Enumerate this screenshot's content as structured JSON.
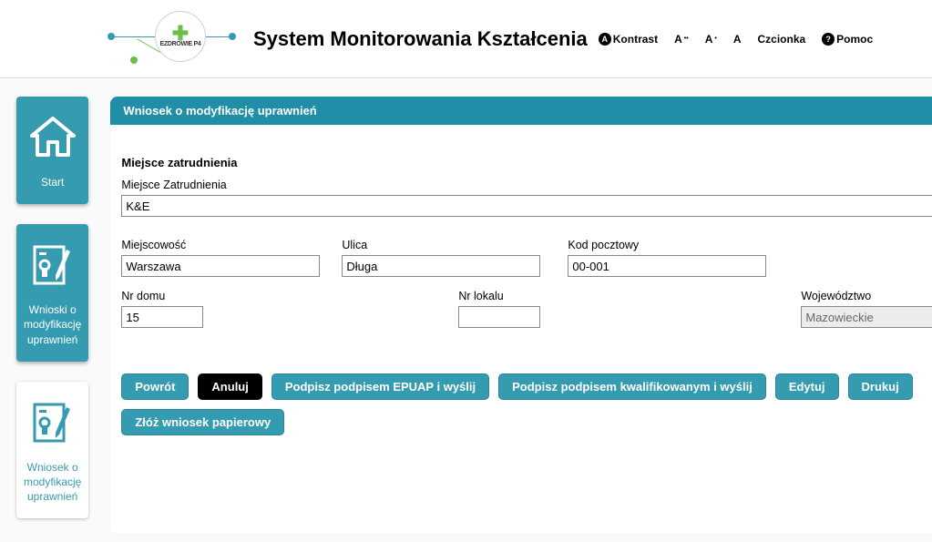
{
  "header": {
    "logo_text": "EZDROWIE P4",
    "app_title": "System Monitorowania Kształcenia",
    "kontrast": "Kontrast",
    "a_large": "A",
    "a_med": "A",
    "a_small": "A",
    "czcionka": "Czcionka",
    "pomoc": "Pomoc"
  },
  "sidebar": {
    "items": [
      {
        "label": "Start"
      },
      {
        "label": "Wnioski o\nmodyfikację\nuprawnień"
      },
      {
        "label": "Wniosek o\nmodyfikację\nuprawnień"
      }
    ]
  },
  "panel": {
    "title": "Wniosek o modyfikację uprawnień",
    "section_title": "Miejsce zatrudnienia",
    "fields": {
      "miejsce_label": "Miejsce Zatrudnienia",
      "miejsce_value": "K&E",
      "miejscowosc_label": "Miejscowość",
      "miejscowosc_value": "Warszawa",
      "ulica_label": "Ulica",
      "ulica_value": "Długa",
      "kod_label": "Kod pocztowy",
      "kod_value": "00-001",
      "nrdomu_label": "Nr domu",
      "nrdomu_value": "15",
      "nrlokalu_label": "Nr lokalu",
      "nrlokalu_value": "",
      "woj_label": "Województwo",
      "woj_value": "Mazowieckie"
    }
  },
  "buttons": {
    "powrot": "Powrót",
    "anuluj": "Anuluj",
    "epuap": "Podpisz podpisem EPUAP i wyślij",
    "kwalif": "Podpisz podpisem kwalifikowanym i wyślij",
    "edytuj": "Edytuj",
    "drukuj": "Drukuj",
    "papier": "Złóż wniosek papierowy"
  }
}
